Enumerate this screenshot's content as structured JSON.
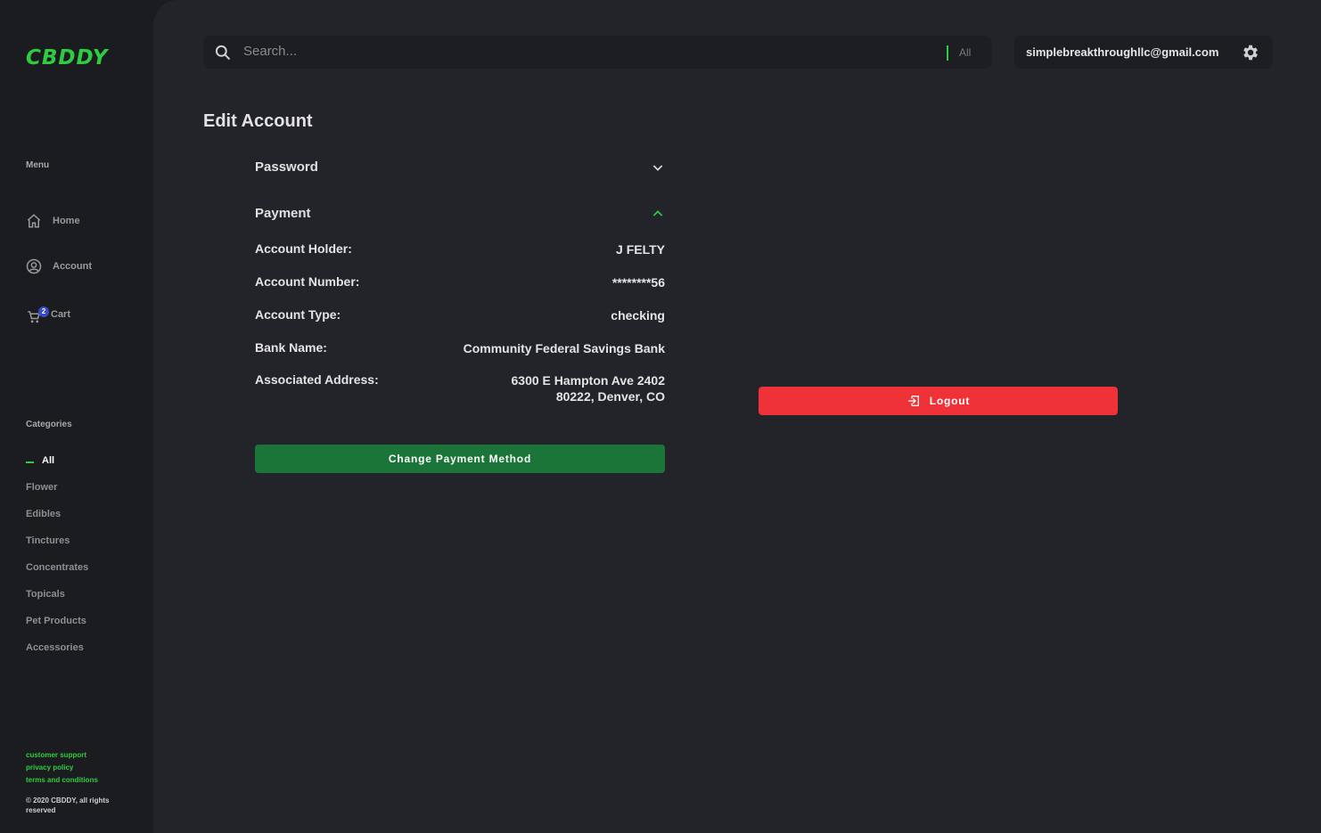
{
  "brand": {
    "logo": "CBDDY",
    "accent": "#2ecc40"
  },
  "sidebar": {
    "menu_heading": "Menu",
    "nav": [
      {
        "label": "Home",
        "icon": "home-icon"
      },
      {
        "label": "Account",
        "icon": "account-icon"
      },
      {
        "label": "Cart",
        "icon": "cart-icon",
        "badge": "2"
      }
    ],
    "categories_heading": "Categories",
    "categories": [
      "All",
      "Flower",
      "Edibles",
      "Tinctures",
      "Concentrates",
      "Topicals",
      "Pet Products",
      "Accessories"
    ],
    "active_category": "All",
    "footer_links": [
      "customer support",
      "privacy policy",
      "terms and conditions"
    ],
    "copyright": "© 2020 CBDDY, all rights reserved"
  },
  "header": {
    "search_placeholder": "Search...",
    "search_scope": "All",
    "user_email": "simplebreakthroughllc@gmail.com"
  },
  "page": {
    "title": "Edit Account",
    "sections": [
      {
        "label": "Password",
        "expanded": false
      },
      {
        "label": "Payment",
        "expanded": true
      }
    ],
    "payment": {
      "account_holder_label": "Account Holder:",
      "account_holder": "J FELTY",
      "account_number_label": "Account Number:",
      "account_number": "********56",
      "account_type_label": "Account Type:",
      "account_type": "checking",
      "bank_name_label": "Bank Name:",
      "bank_name": "Community Federal Savings Bank",
      "address_label": "Associated Address:",
      "address_line1": "6300 E Hampton Ave 2402",
      "address_line2": "80222, Denver, CO"
    },
    "change_payment_label": "Change Payment Method",
    "logout_label": "Logout"
  },
  "colors": {
    "logout": "#ee3237",
    "change_payment": "#1b7539",
    "badge": "#3949c9"
  }
}
